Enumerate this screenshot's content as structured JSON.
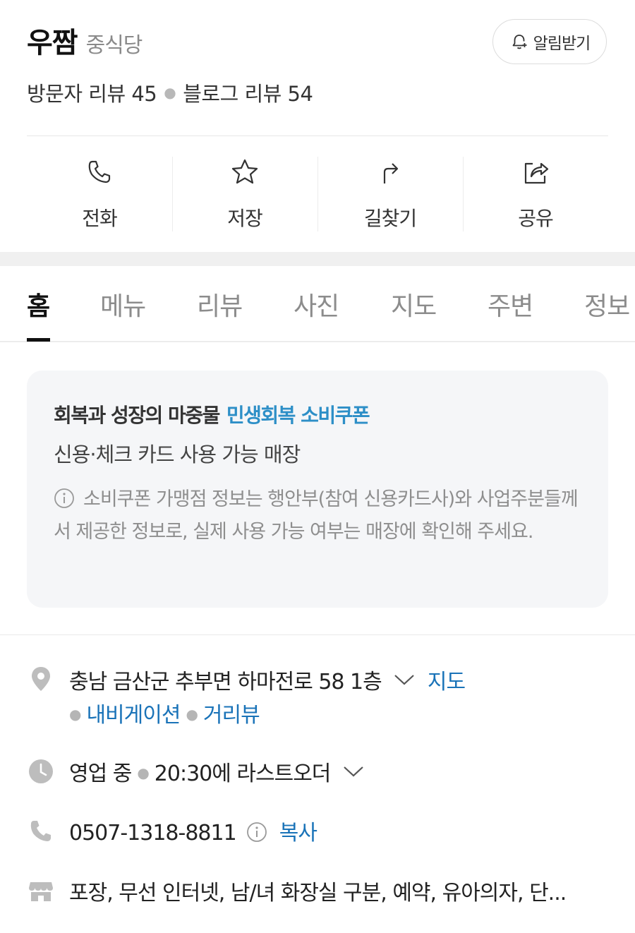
{
  "header": {
    "name": "우짬",
    "category": "중식당",
    "alarm_label": "알림받기",
    "visitor_review": "방문자 리뷰 45",
    "blog_review": "블로그 리뷰 54"
  },
  "actions": [
    {
      "label": "전화",
      "icon": "phone-icon"
    },
    {
      "label": "저장",
      "icon": "star-icon"
    },
    {
      "label": "길찾기",
      "icon": "directions-icon"
    },
    {
      "label": "공유",
      "icon": "share-icon"
    }
  ],
  "tabs": [
    "홈",
    "메뉴",
    "리뷰",
    "사진",
    "지도",
    "주변",
    "정보"
  ],
  "active_tab": "홈",
  "coupon": {
    "title_prefix": "회복과 성장의 마중물",
    "title_highlight": "민생회복 소비쿠폰",
    "subtitle": "신용·체크 카드 사용 가능 매장",
    "note": "소비쿠폰 가맹점 정보는 행안부(참여 신용카드사)와 사업주분들께서 제공한 정보로, 실제 사용 가능 여부는 매장에 확인해 주세요."
  },
  "address": {
    "text": "충남 금산군 추부면 하마전로 58 1층",
    "map_link": "지도",
    "nav_link": "내비게이션",
    "street_link": "거리뷰"
  },
  "hours": {
    "status": "영업 중",
    "last_order": "20:30에 라스트오더"
  },
  "phone": {
    "number": "0507-1318-8811",
    "copy_label": "복사"
  },
  "amenities": "포장, 무선 인터넷, 남/녀 화장실 구분, 예약, 유아의자, 단...",
  "colors": {
    "accent_blue": "#1a73b8",
    "coupon_highlight": "#2d8fc7",
    "card_bg": "#f5f6f8"
  }
}
